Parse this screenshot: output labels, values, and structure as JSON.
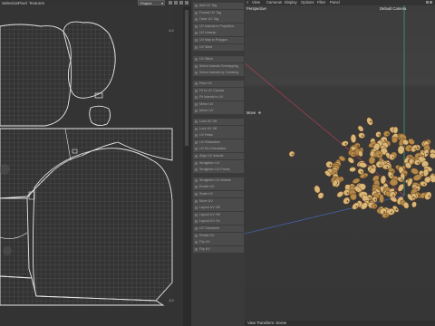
{
  "uv_editor": {
    "menus": [
      "Selection",
      "Pixel",
      "Textures"
    ],
    "mode": "Project",
    "coord_top": "1,0",
    "coord_bottom": "1,0"
  },
  "commands": [
    "Add UV Tag",
    "Frontal UV Tag",
    "Clear UV Tag",
    "UV Islands to Projection",
    "UV Unwrap",
    "UV Map to Polygon",
    "UV Weld",
    "UV Stitch",
    "Select Islands Overlapping",
    "Select Islands by Checking",
    "Pack UV",
    "Fit to UV Canvas",
    "Fit Islands to UV",
    "Mirror UV",
    "Mirror UV",
    "Lock UV Off",
    "Lock UV Off",
    "UV Relax",
    "UV Relaxation",
    "UV Re-Orientation",
    "Align UV Islands",
    "Straighten UV",
    "Straighten UV Points",
    "Straighten UV Islands",
    "Rotate UV",
    "Scale UV",
    "Move UV",
    "Layout UV Off",
    "Layout UV Off",
    "Layout UV On",
    "UV Transform",
    "Rotate UV",
    "Flip UV",
    "Flip UV"
  ],
  "viewport": {
    "menus": [
      "View",
      "Cameras",
      "Display",
      "Options",
      "Filter",
      "Panel"
    ],
    "camera_label": "Perspective",
    "camera_name": "Default Camera",
    "tool_label": "Move",
    "tool_icon": "move-icon",
    "status": "View Transform: Scene"
  },
  "colors": {
    "panel_bg": "#3a3a3a",
    "uv_line": "#e8e8e8",
    "uv_grid": "#6a6a6a",
    "axis_y": "#3fbf8f",
    "axis_x": "#c0405a",
    "axis_z": "#4a6fd0",
    "seed_light": "#d9b778",
    "seed_dark": "#6b4420"
  }
}
